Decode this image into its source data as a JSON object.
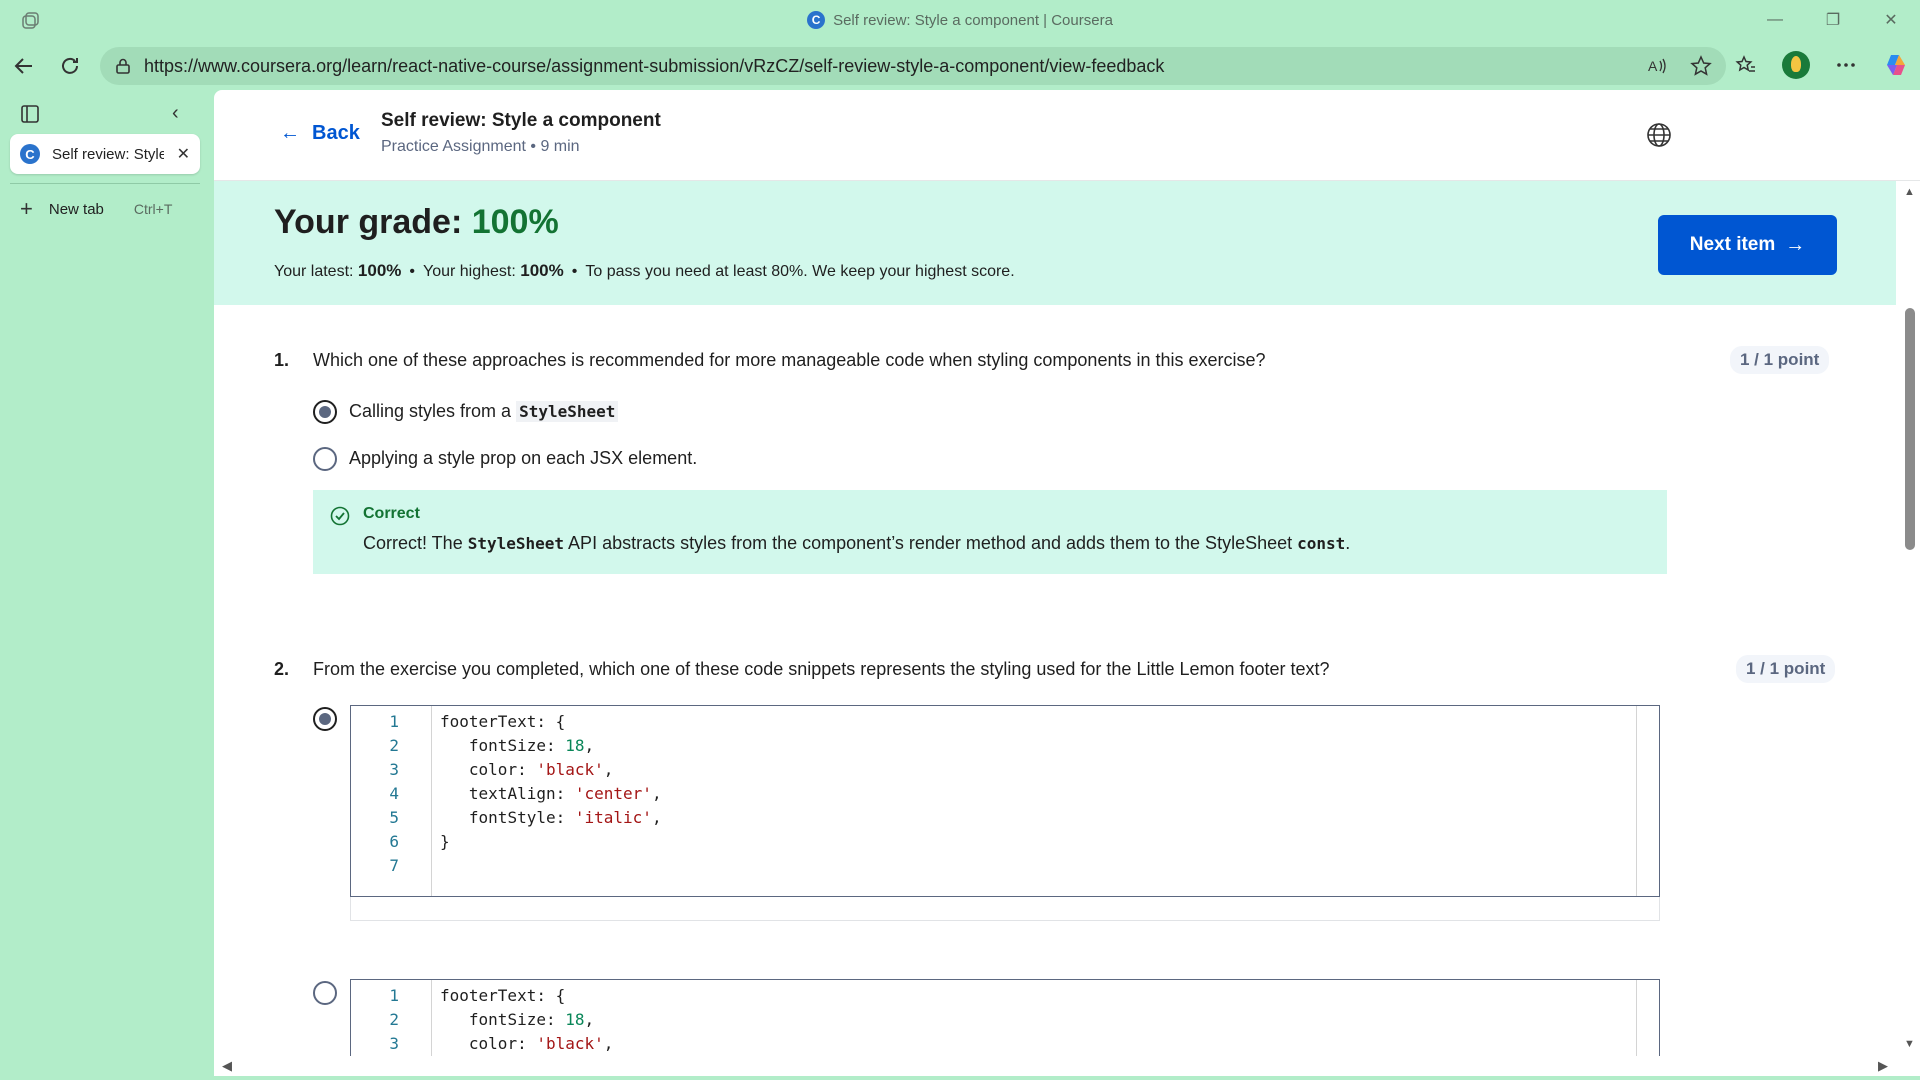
{
  "browser": {
    "window_title": "Self review: Style a component | Coursera",
    "favicon_letter": "C",
    "url": "https://www.coursera.org/learn/react-native-course/assignment-submission/vRzCZ/self-review-style-a-component/view-feedback",
    "controls": {
      "minimize": "—",
      "restore": "❐",
      "close": "✕"
    },
    "tab": {
      "label": "Self review: Style a component",
      "close": "✕"
    },
    "new_tab": {
      "label": "New tab",
      "shortcut": "Ctrl+T"
    },
    "icons": [
      "tabs-icon",
      "back-icon",
      "reload-icon",
      "lock-icon",
      "read-aloud-icon",
      "favorite-star-icon",
      "favorites-icon",
      "profile-avatar",
      "more-icon",
      "copilot-icon"
    ]
  },
  "header": {
    "back_label": "Back",
    "title": "Self review: Style a component",
    "subtitle": "Practice Assignment • 9 min"
  },
  "grade": {
    "title_prefix": "Your grade: ",
    "value": "100%",
    "latest_label": "Your latest: ",
    "latest_value": "100%",
    "highest_label": "Your highest: ",
    "highest_value": "100%",
    "pass_note": "To pass you need at least 80%. We keep your highest score.",
    "next_button": "Next item"
  },
  "questions": [
    {
      "number": "1.",
      "text": "Which one of these approaches is recommended for more manageable code when styling components in this exercise?",
      "points": "1 / 1 point",
      "options": [
        {
          "text": "Calling styles from a ",
          "code": "StyleSheet",
          "selected": true
        },
        {
          "text": "Applying a style prop on each JSX element.",
          "selected": false
        }
      ],
      "feedback": {
        "title": "Correct",
        "text_a": "Correct! The ",
        "code_a": "StyleSheet",
        "text_b": " API abstracts styles from the component’s render method and adds them to the StyleSheet ",
        "code_b": "const",
        "text_c": "."
      }
    },
    {
      "number": "2.",
      "text": "From the exercise you completed, which one of these code snippets represents the styling used for the Little Lemon footer text?",
      "points": "1 / 1 point",
      "snippet_1": {
        "selected": true,
        "lines": [
          {
            "n": "1",
            "indent": "",
            "parts": [
              [
                "footerText: {",
                "p"
              ]
            ]
          },
          {
            "n": "2",
            "indent": "   ",
            "parts": [
              [
                "fontSize: ",
                "p"
              ],
              [
                "18",
                "num"
              ],
              [
                ",",
                "p"
              ]
            ]
          },
          {
            "n": "3",
            "indent": "   ",
            "parts": [
              [
                "color: ",
                "p"
              ],
              [
                "'black'",
                "str"
              ],
              [
                ",",
                "p"
              ]
            ]
          },
          {
            "n": "4",
            "indent": "   ",
            "parts": [
              [
                "textAlign: ",
                "p"
              ],
              [
                "'center'",
                "str"
              ],
              [
                ",",
                "p"
              ]
            ]
          },
          {
            "n": "5",
            "indent": "   ",
            "parts": [
              [
                "fontStyle: ",
                "p"
              ],
              [
                "'italic'",
                "str"
              ],
              [
                ",",
                "p"
              ]
            ]
          },
          {
            "n": "6",
            "indent": "",
            "parts": [
              [
                "}",
                "p"
              ]
            ]
          },
          {
            "n": "7",
            "indent": "",
            "parts": []
          }
        ]
      },
      "snippet_2": {
        "selected": false,
        "lines": [
          {
            "n": "1",
            "indent": "",
            "parts": [
              [
                "footerText: {",
                "p"
              ]
            ]
          },
          {
            "n": "2",
            "indent": "   ",
            "parts": [
              [
                "fontSize: ",
                "p"
              ],
              [
                "18",
                "num"
              ],
              [
                ",",
                "p"
              ]
            ]
          },
          {
            "n": "3",
            "indent": "   ",
            "parts": [
              [
                "color: ",
                "p"
              ],
              [
                "'black'",
                "str"
              ],
              [
                ",",
                "p"
              ]
            ]
          }
        ]
      }
    }
  ],
  "colors": {
    "accent": "#0056d2",
    "success": "#137333",
    "banner": "#d2f8ec",
    "browser_frame": "#b2edc9"
  }
}
